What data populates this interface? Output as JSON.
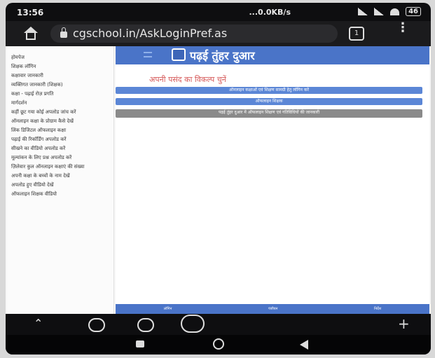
{
  "status_bar": {
    "time": "13:56",
    "net_speed": "...0.0KB/s",
    "battery": "46"
  },
  "browser": {
    "url": "cgschool.in/AskLoginPref.as",
    "tabs_count": "1"
  },
  "sidebar": {
    "items": [
      "होमपेज",
      "शिक्षक लॉगिन",
      "कक्षावार जानकारी",
      "व्यक्तिगत जानकारी (शिक्षक)",
      "कक्षा - पढ़ाई रोज़ प्रगति",
      "मार्गदर्शन",
      "कहीं छूट गया कोई अपलोड जांच करें",
      "ऑनलाइन कक्षा के प्रोग्राम कैसे देखें",
      "लिंक डिजिटल ऑफलाइन कक्षा",
      "पढ़ाई की रिकॉर्डिंग अपलोड करें",
      "सीखने का वीडियो अपलोड करें",
      "मूल्यांकन के लिए प्रश्न अपलोड करें",
      "ज़िलेवार कुल ऑनलाइन कक्षाएं की संख्या",
      "अपनी कक्षा के बच्चों के नाम देखें",
      "अपलोड हुए वीडियो देखें",
      "ऑफलाइन शिक्षक वीडियो"
    ]
  },
  "main": {
    "banner_title": "पढ़ई तुंहर दुआर",
    "heading": "अपनी पसंद का विकल्प चुनें",
    "option_1": "ऑनलाइन कक्षाओं एवं शिक्षण सामग्री हेतु लॉगिन करें",
    "option_2": "ऑफलाइन शिक्षक",
    "option_3": "पढ़ई तुंहर दुआर में ऑफलाइन शिक्षण एवं गतिविधियों की जानकारी",
    "bottom_nav": [
      "लॉगिन",
      "पंजीयन",
      "निर्देश"
    ]
  },
  "colors": {
    "banner": "#4a74c8",
    "option_bar": "#5b86d6",
    "heading": "#d65a5a"
  }
}
